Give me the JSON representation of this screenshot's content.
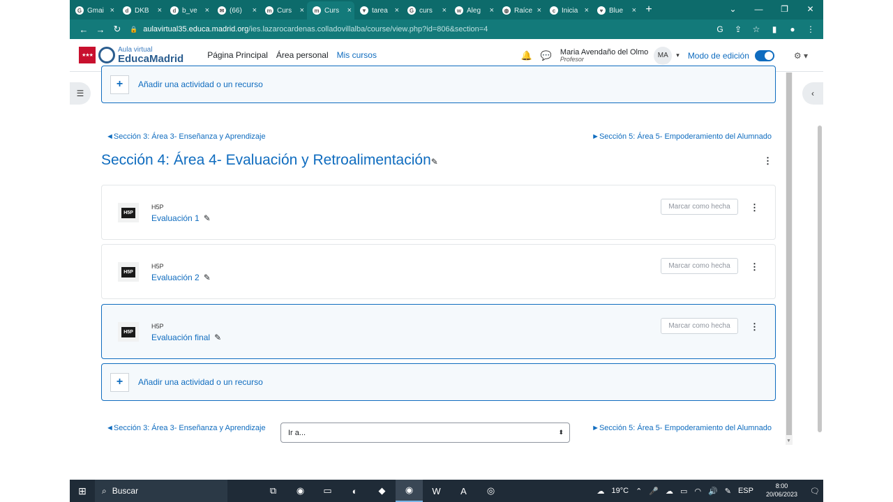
{
  "browser": {
    "tabs": [
      {
        "label": "Gmai",
        "icon": "google-icon"
      },
      {
        "label": "DKB",
        "icon": "dkb-icon"
      },
      {
        "label": "b_ve",
        "icon": "dkb-icon"
      },
      {
        "label": "(66)",
        "icon": "mail-icon"
      },
      {
        "label": "Curs",
        "icon": "moodle-icon"
      },
      {
        "label": "Curs",
        "icon": "moodle-icon",
        "active": true
      },
      {
        "label": "tarea",
        "icon": "shield-icon"
      },
      {
        "label": "curs",
        "icon": "google-icon"
      },
      {
        "label": "Aleg",
        "icon": "site-icon"
      },
      {
        "label": "Raíce",
        "icon": "globe-icon"
      },
      {
        "label": "Inicia",
        "icon": "canva-icon"
      },
      {
        "label": "Blue",
        "icon": "heart-icon"
      }
    ],
    "new_tab": "+",
    "url_host": "aulavirtual35.educa.madrid.org",
    "url_path": "/ies.lazarocardenas.colladovillalba/course/view.php?id=806&section=4"
  },
  "header": {
    "logo_line1": "Aula virtual",
    "logo_line2": "EducaMadrid",
    "nav": [
      {
        "label": "Página Principal"
      },
      {
        "label": "Área personal"
      },
      {
        "label": "Mis cursos",
        "active": true
      }
    ],
    "user_name": "Maria Avendaño del Olmo",
    "user_role": "Profesor",
    "avatar_initials": "MA",
    "edit_mode_label": "Modo de edición",
    "edit_mode_on": true
  },
  "section": {
    "add_activity_label": "Añadir una actividad o un recurso",
    "prev_link": "◄Sección 3: Área 3- Enseñanza y Aprendizaje",
    "next_link": "►Sección 5: Área 5- Empoderamiento del Alumnado",
    "title": "Sección 4: Área 4- Evaluación y Retroalimentación",
    "activities": [
      {
        "type": "H5P",
        "name": "Evaluación 1",
        "mark_label": "Marcar como hecha"
      },
      {
        "type": "H5P",
        "name": "Evaluación 2",
        "mark_label": "Marcar como hecha"
      },
      {
        "type": "H5P",
        "name": "Evaluación final",
        "mark_label": "Marcar como hecha"
      }
    ],
    "jump_placeholder": "Ir a..."
  },
  "taskbar": {
    "search_label": "Buscar",
    "weather": "19°C",
    "language": "ESP",
    "time": "8:00",
    "date": "20/06/2023"
  },
  "colors": {
    "browser_frame": "#0d6b6b",
    "accent": "#0f6cbf",
    "taskbar": "#1f2b37"
  }
}
